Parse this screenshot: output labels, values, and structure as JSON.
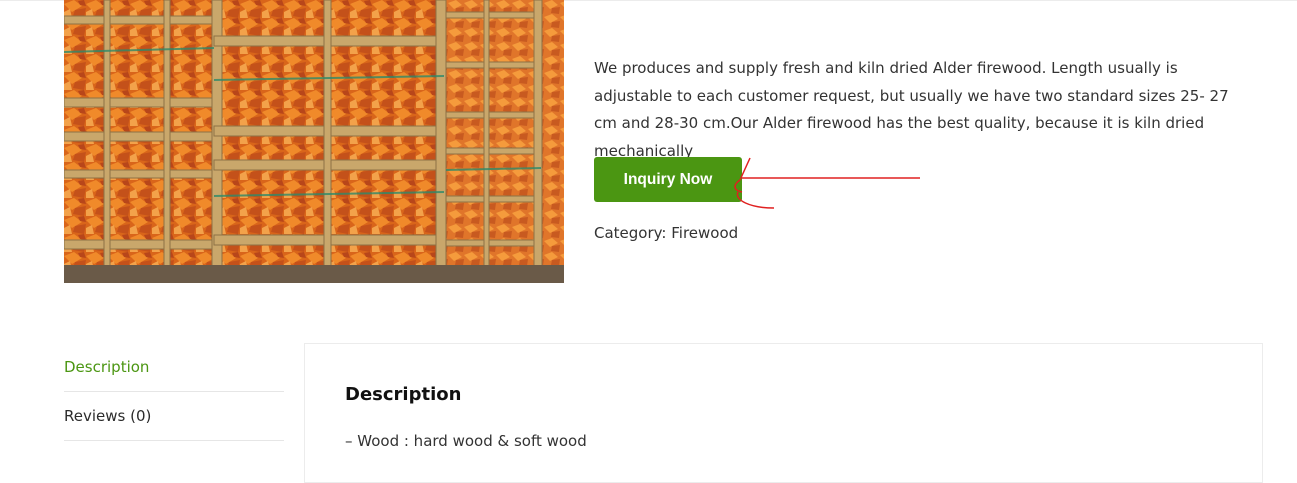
{
  "product": {
    "image_alt": "Alder firewood stacked in wooden crates",
    "description": "We produces and supply fresh and kiln dried Alder firewood. Length usually is adjustable to each customer request, but usually we have two standard sizes 25- 27 cm and 28-30 cm.Our Alder firewood has the best quality, because it is kiln dried mechanically",
    "inquiry_button_label": "Inquiry Now",
    "category_label": "Category:",
    "category_value": "Firewood"
  },
  "tabs": {
    "items": [
      {
        "label": "Description",
        "active": true
      },
      {
        "label": "Reviews (0)",
        "active": false
      }
    ]
  },
  "panel": {
    "title": "Description",
    "first_line": "– Wood : hard wood & soft wood"
  },
  "colors": {
    "button_green": "#4b9612",
    "active_tab_green": "#4b9612",
    "annotation_red": "#e02020"
  }
}
